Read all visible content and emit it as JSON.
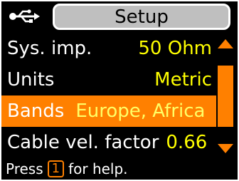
{
  "header": {
    "icon": "usb-icon",
    "title": "Setup"
  },
  "menu": {
    "items": [
      {
        "label": "Sys. imp.",
        "value": "50 Ohm",
        "selected": false
      },
      {
        "label": "Units",
        "value": "Metric",
        "selected": false
      },
      {
        "label": "Bands",
        "value": "Europe, Africa",
        "selected": true
      },
      {
        "label": "Cable vel. factor",
        "value": "0.66",
        "selected": false
      }
    ]
  },
  "scrollbar": {
    "up_icon": "arrow-up-icon",
    "down_icon": "arrow-down-icon"
  },
  "footer": {
    "prefix": "Press",
    "key": "1",
    "suffix": "for help."
  },
  "colors": {
    "background": "#000000",
    "accent": "#ff8000",
    "value": "#ffff00",
    "text": "#ffffff",
    "title_bg": "#bfbfbf"
  }
}
